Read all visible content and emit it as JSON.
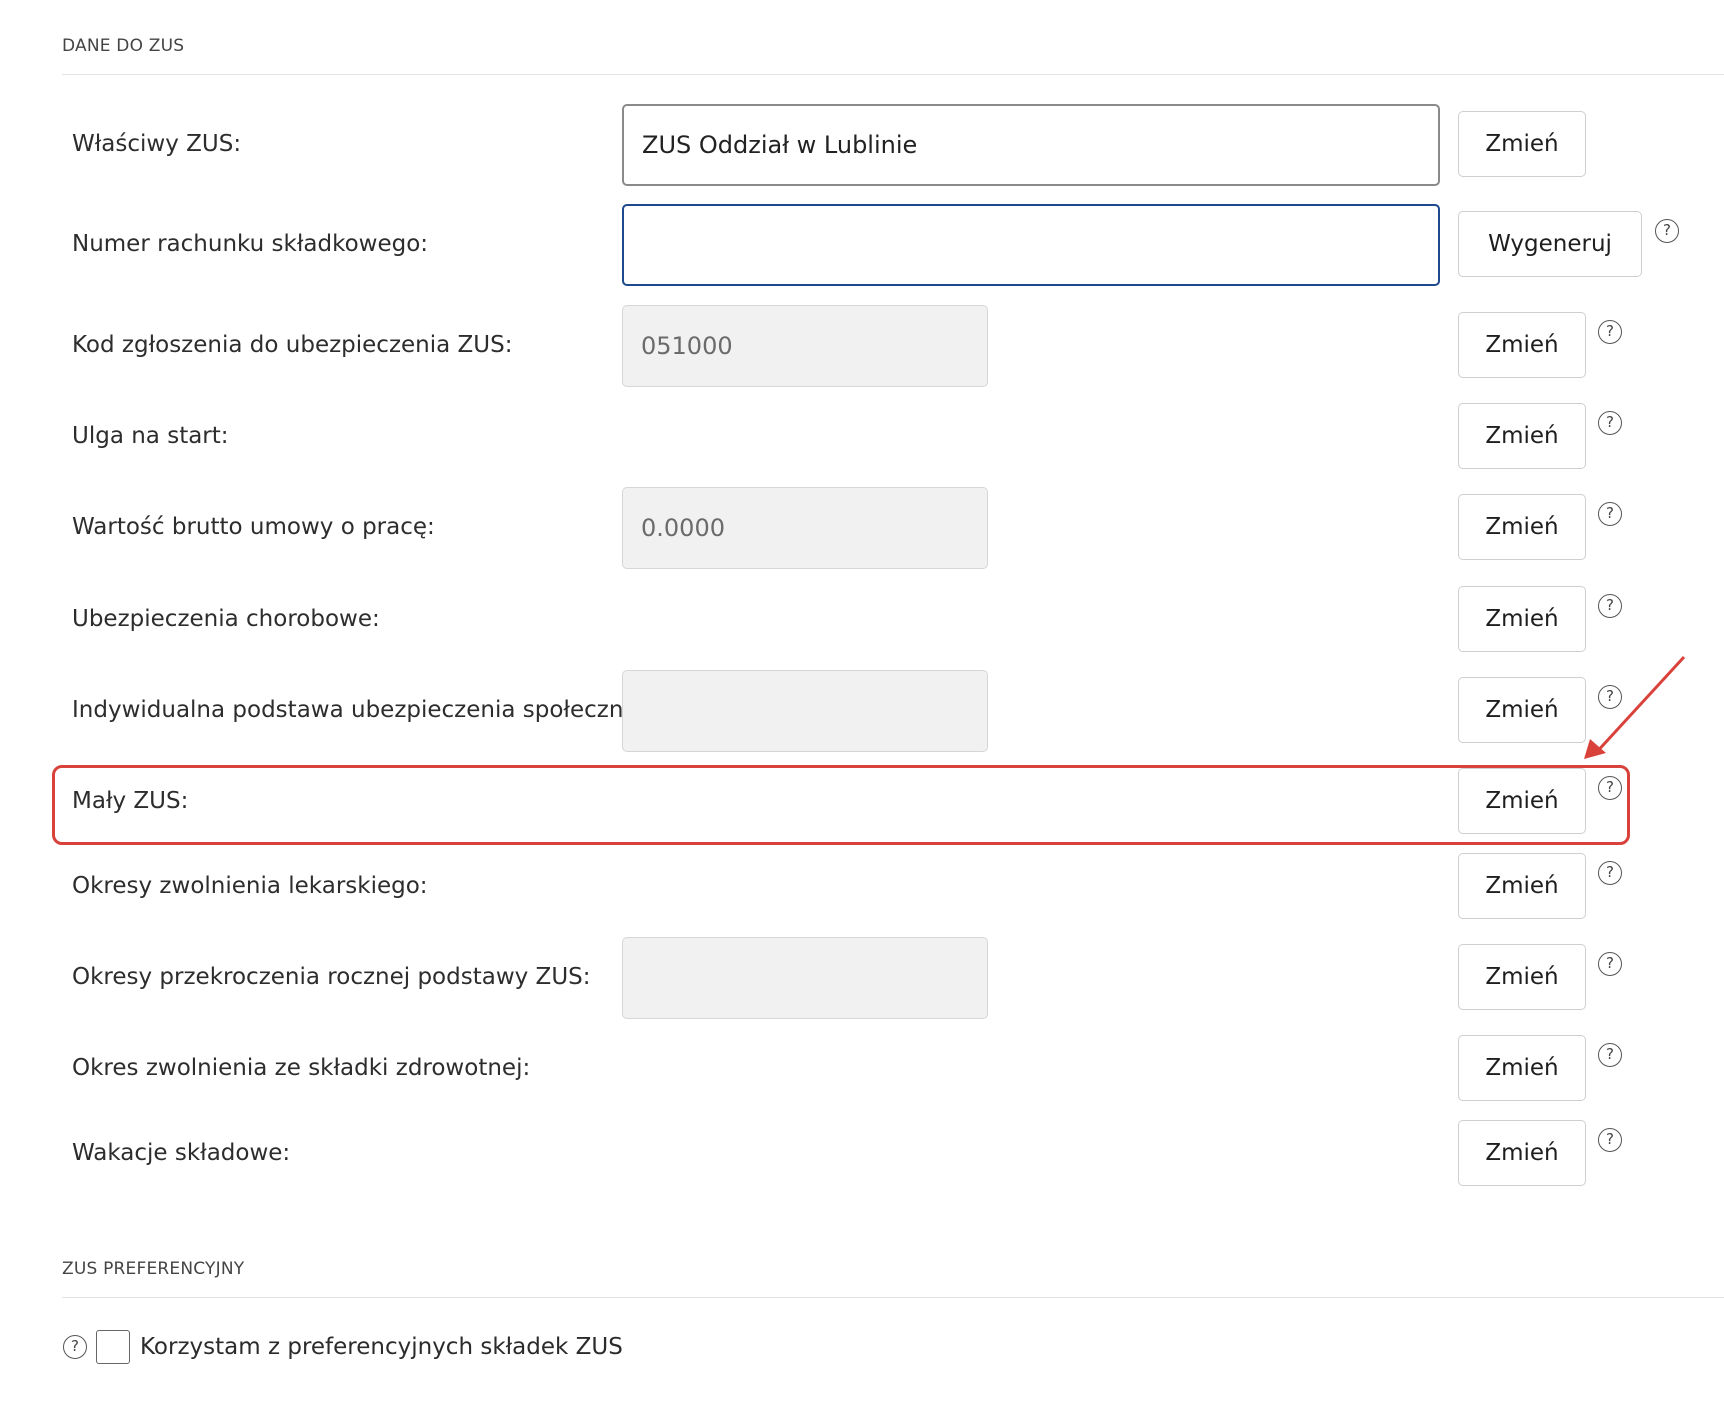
{
  "sections": {
    "zus_data_title": "DANE DO ZUS",
    "preferential_title": "ZUS PREFERENCYJNY"
  },
  "rows": {
    "wlasciwy_zus": {
      "label": "Właściwy ZUS:",
      "value": "ZUS Oddział w Lublinie",
      "button": "Zmień"
    },
    "numer_rachunku": {
      "label": "Numer rachunku składkowego:",
      "value": "",
      "button": "Wygeneruj"
    },
    "kod_zgloszenia": {
      "label": "Kod zgłoszenia do ubezpieczenia ZUS:",
      "value": "051000",
      "button": "Zmień"
    },
    "ulga_na_start": {
      "label": "Ulga na start:",
      "button": "Zmień"
    },
    "wartosc_brutto": {
      "label": "Wartość brutto umowy o pracę:",
      "value": "0.0000",
      "button": "Zmień"
    },
    "ubezpieczenia_chorobowe": {
      "label": "Ubezpieczenia chorobowe:",
      "button": "Zmień"
    },
    "indywidualna_podstawa": {
      "label": "Indywidualna podstawa ubezpieczenia społecznego:",
      "value": "",
      "button": "Zmień"
    },
    "maly_zus": {
      "label": "Mały ZUS:",
      "button": "Zmień"
    },
    "okresy_zwolnienia": {
      "label": "Okresy zwolnienia lekarskiego:",
      "button": "Zmień"
    },
    "okresy_przekroczenia": {
      "label": "Okresy przekroczenia rocznej podstawy ZUS:",
      "value": "",
      "button": "Zmień"
    },
    "okres_zwolnienia_zdrowotnej": {
      "label": "Okres zwolnienia ze składki zdrowotnej:",
      "button": "Zmień"
    },
    "wakacje_skladowe": {
      "label": "Wakacje składowe:",
      "button": "Zmień"
    }
  },
  "preferential": {
    "checkbox_label": "Korzystam z preferencyjnych składek ZUS",
    "checked": false
  },
  "help_glyph": "?",
  "icons": [
    "help-icon",
    "arrow-annotation"
  ],
  "colors": {
    "highlight": "#d9423a",
    "focus_border": "#1d4a8c"
  }
}
